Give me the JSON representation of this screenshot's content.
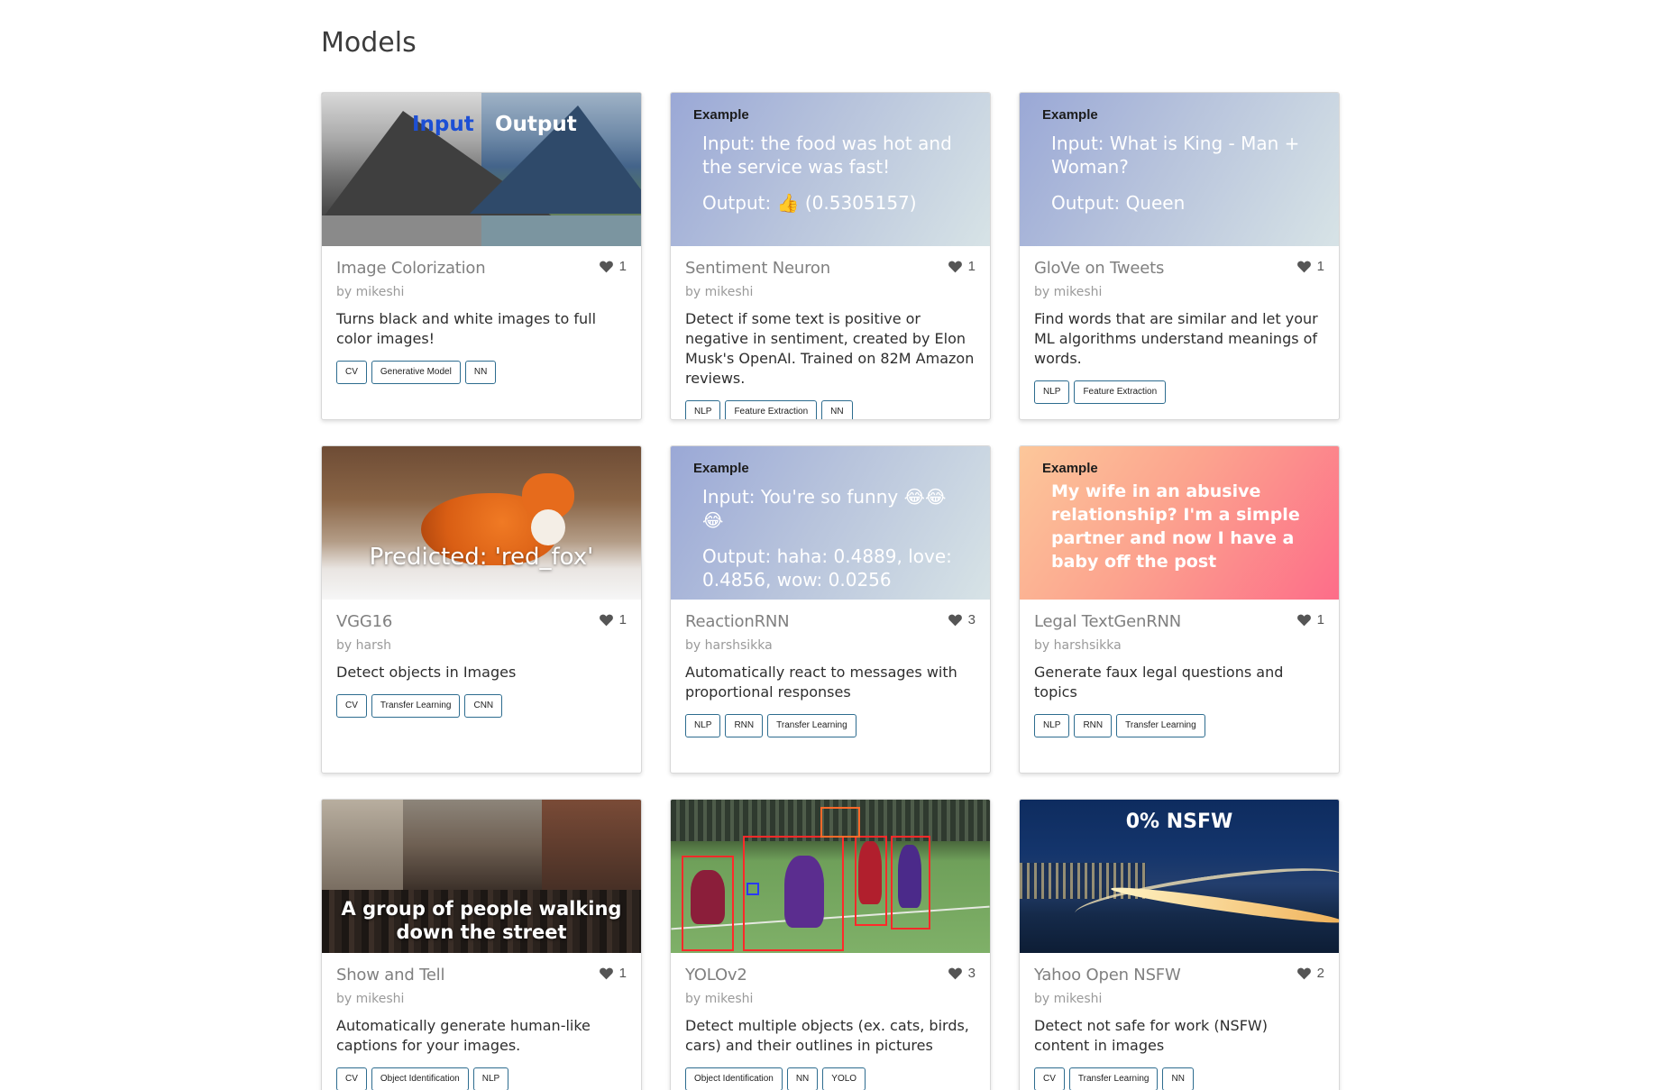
{
  "page": {
    "title": "Models"
  },
  "cards": [
    {
      "title": "Image Colorization",
      "author": "by mikeshi",
      "likes": "1",
      "description": "Turns black and white images to full color images!",
      "tags": [
        "CV",
        "Generative Model",
        "NN"
      ],
      "thumb": {
        "kind": "image",
        "label_input": "Input",
        "label_output": "Output"
      }
    },
    {
      "title": "Sentiment Neuron",
      "author": "by mikeshi",
      "likes": "1",
      "description": "Detect if some text is positive or negative in sentiment, created by Elon Musk's OpenAI. Trained on 82M Amazon reviews.",
      "tags": [
        "NLP",
        "Feature Extraction",
        "NN"
      ],
      "thumb": {
        "kind": "example",
        "label": "Example",
        "input": "Input: the food was hot and the service was fast!",
        "output": "Output: 👍 (0.5305157)"
      }
    },
    {
      "title": "GloVe on Tweets",
      "author": "by mikeshi",
      "likes": "1",
      "description": "Find words that are similar and let your ML algorithms understand meanings of words.",
      "tags": [
        "NLP",
        "Feature Extraction"
      ],
      "thumb": {
        "kind": "example",
        "label": "Example",
        "input": "Input: What is King - Man + Woman?",
        "output": "Output: Queen"
      }
    },
    {
      "title": "VGG16",
      "author": "by harsh",
      "likes": "1",
      "description": "Detect objects in Images",
      "tags": [
        "CV",
        "Transfer Learning",
        "CNN"
      ],
      "thumb": {
        "kind": "image",
        "caption": "Predicted: 'red_fox'"
      }
    },
    {
      "title": "ReactionRNN",
      "author": "by harshsikka",
      "likes": "3",
      "description": "Automatically react to messages with proportional responses",
      "tags": [
        "NLP",
        "RNN",
        "Transfer Learning"
      ],
      "thumb": {
        "kind": "example",
        "label": "Example",
        "input": "Input: You're so funny 😂😂😂",
        "output": "Output: haha: 0.4889, love: 0.4856, wow: 0.0256"
      }
    },
    {
      "title": "Legal TextGenRNN",
      "author": "by harshsikka",
      "likes": "1",
      "description": "Generate faux legal questions and topics",
      "tags": [
        "NLP",
        "RNN",
        "Transfer Learning"
      ],
      "thumb": {
        "kind": "example",
        "label": "Example",
        "text": "My wife in an abusive relationship? I'm a simple partner and now I have a baby off the post"
      }
    },
    {
      "title": "Show and Tell",
      "author": "by mikeshi",
      "likes": "1",
      "description": "Automatically generate human-like captions for your images.",
      "tags": [
        "CV",
        "Object Identification",
        "NLP"
      ],
      "thumb": {
        "kind": "image",
        "caption": "A group of people walking down the street"
      }
    },
    {
      "title": "YOLOv2",
      "author": "by mikeshi",
      "likes": "3",
      "description": "Detect multiple objects (ex. cats, birds, cars) and their outlines in pictures",
      "tags": [
        "Object Identification",
        "NN",
        "YOLO"
      ],
      "thumb": {
        "kind": "image"
      }
    },
    {
      "title": "Yahoo Open NSFW",
      "author": "by mikeshi",
      "likes": "2",
      "description": "Detect not safe for work (NSFW) content in images",
      "tags": [
        "CV",
        "Transfer Learning",
        "NN"
      ],
      "thumb": {
        "kind": "image",
        "caption": "0% NSFW"
      }
    }
  ],
  "icons": {
    "like": "heart-icon"
  },
  "colors": {
    "tag_border": "#2d6c8f",
    "heart": "#555555"
  }
}
